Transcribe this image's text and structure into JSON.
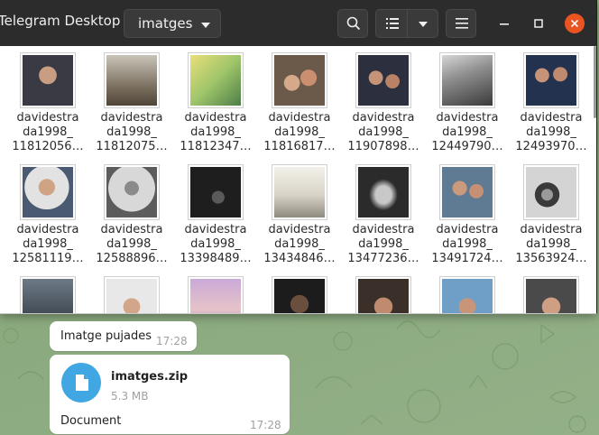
{
  "window": {
    "title": "Telegram Desktop",
    "location": "imatges"
  },
  "icons": {
    "search": "search-icon",
    "list_view": "list-view-icon",
    "view_options": "chevron-down-icon",
    "menu": "hamburger-menu-icon",
    "minimize": "minimize-icon",
    "maximize": "maximize-icon",
    "close": "close-icon",
    "file": "document-icon"
  },
  "colors": {
    "headerbar": "#2c2c2c",
    "close_button": "#e95420",
    "file_circle": "#40a7e3"
  },
  "files": [
    {
      "line1": "davidestra",
      "line2": "da1998_",
      "line3": "11812056…"
    },
    {
      "line1": "davidestra",
      "line2": "da1998_",
      "line3": "11812075…"
    },
    {
      "line1": "davidestra",
      "line2": "da1998_",
      "line3": "11812347…"
    },
    {
      "line1": "davidestra",
      "line2": "da1998_",
      "line3": "11816817…"
    },
    {
      "line1": "davidestra",
      "line2": "da1998_",
      "line3": "11907898…"
    },
    {
      "line1": "davidestra",
      "line2": "da1998_",
      "line3": "12449790…"
    },
    {
      "line1": "davidestra",
      "line2": "da1998_",
      "line3": "12493970…"
    },
    {
      "line1": "davidestra",
      "line2": "da1998_",
      "line3": "12581119…"
    },
    {
      "line1": "davidestra",
      "line2": "da1998_",
      "line3": "12588896…"
    },
    {
      "line1": "davidestra",
      "line2": "da1998_",
      "line3": "13398489…"
    },
    {
      "line1": "davidestra",
      "line2": "da1998_",
      "line3": "13434846…"
    },
    {
      "line1": "davidestra",
      "line2": "da1998_",
      "line3": "13477236…"
    },
    {
      "line1": "davidestra",
      "line2": "da1998_",
      "line3": "13491724…"
    },
    {
      "line1": "davidestra",
      "line2": "da1998_",
      "line3": "13563924…"
    }
  ],
  "messages": {
    "caption": {
      "text": "Imatge pujades",
      "time": "17:28"
    },
    "file": {
      "name": "imatges.zip",
      "size": "5.3 MB",
      "caption": "Document",
      "time": "17:28"
    }
  }
}
